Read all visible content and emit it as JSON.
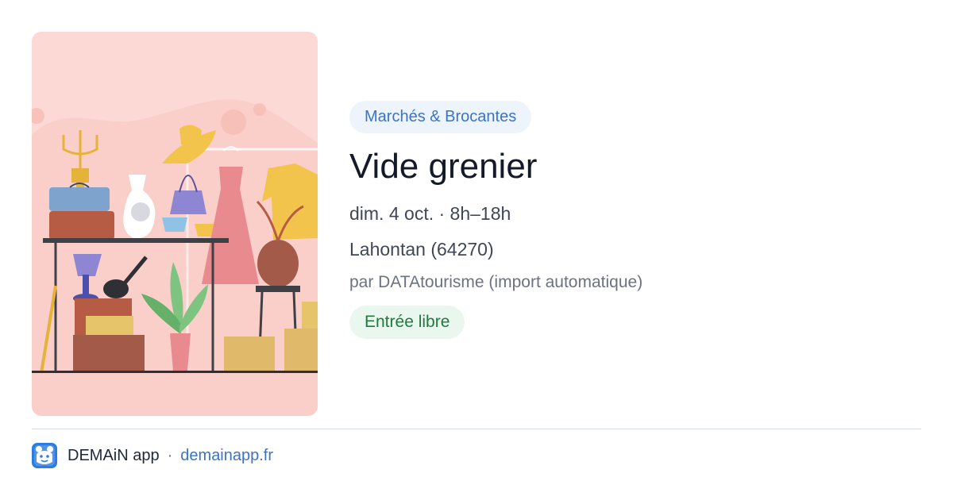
{
  "card": {
    "image_alt": "brocante illustration",
    "category": "Marchés & Brocantes",
    "title": "Vide grenier",
    "date": "dim. 4 oct. · 8h–18h",
    "location": "Lahontan (64270)",
    "source": "par DATAtourisme (import automatique)",
    "price": "Entrée libre"
  },
  "footer": {
    "logo_icon": "demain-app-logo-icon",
    "brand": "DEMAiN app",
    "separator": "·",
    "site": "demainapp.fr"
  },
  "colors": {
    "category_bg": "#eef4fc",
    "category_text": "#3b73c7",
    "price_bg": "#eaf7ee",
    "price_text": "#1f7a3d",
    "hero_bg": "#fcd9d5",
    "link": "#3b73c7"
  }
}
